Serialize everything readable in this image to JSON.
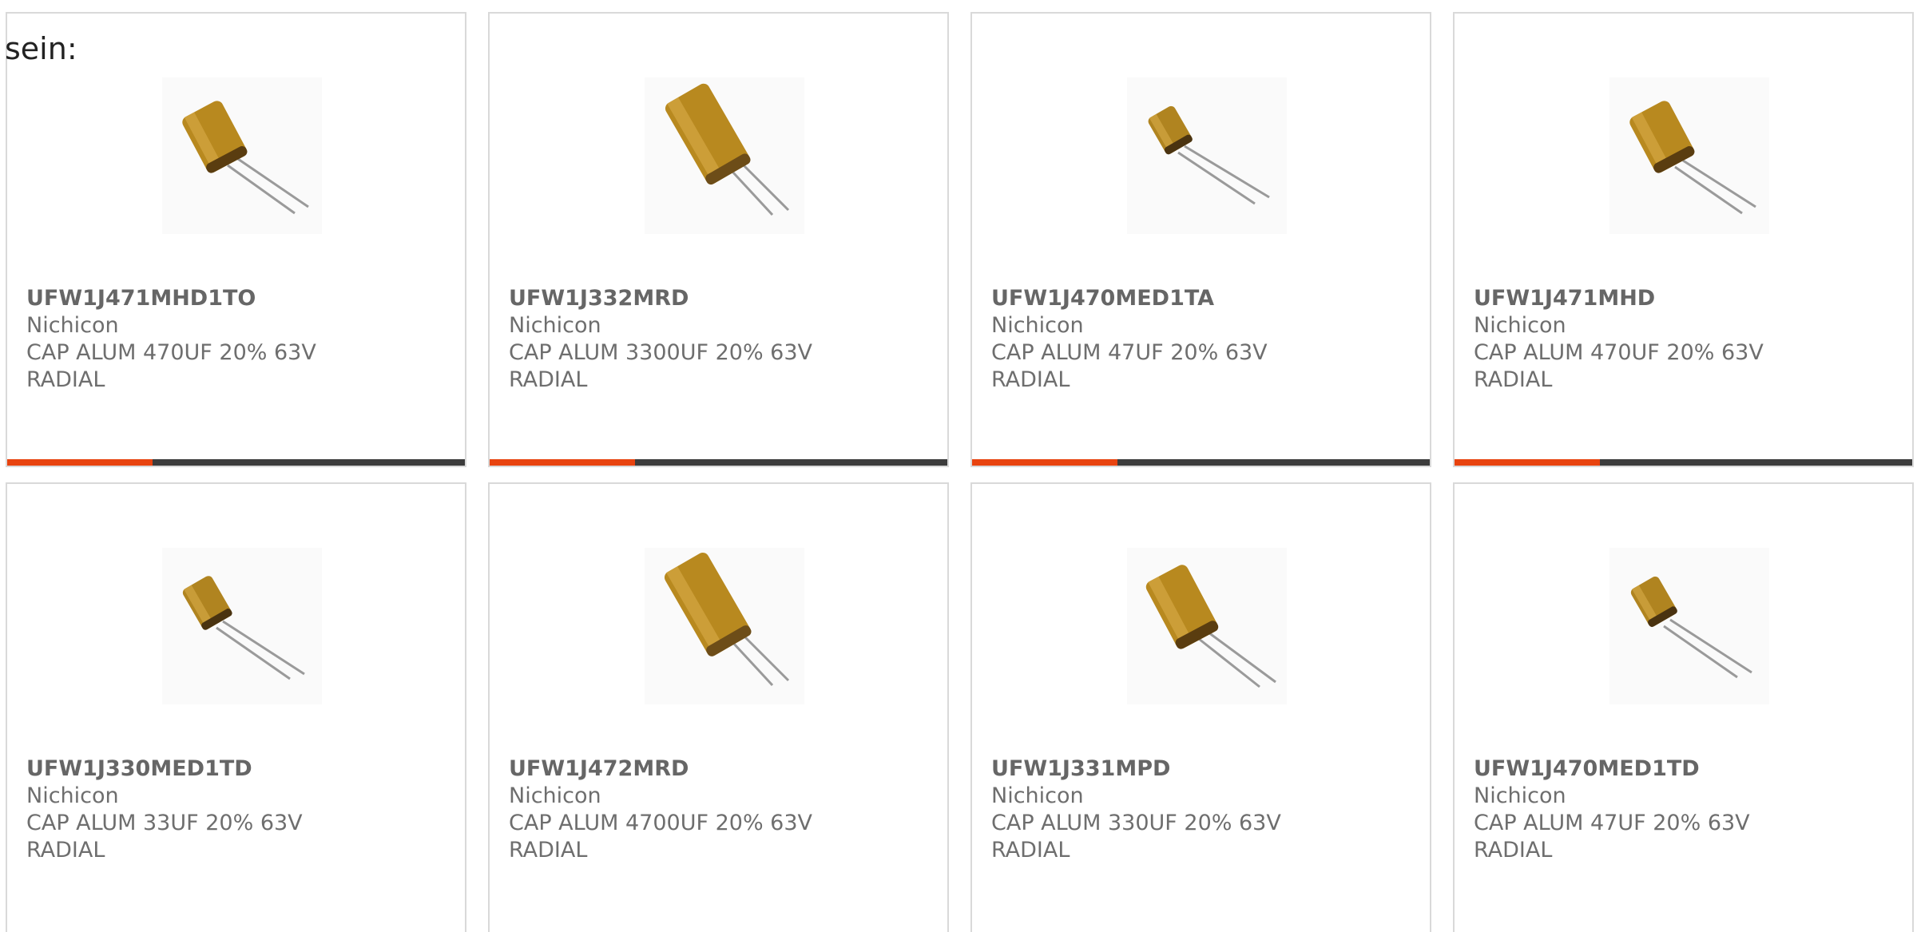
{
  "intro_text": "sein:",
  "accent_color": "#e8430f",
  "bar_color": "#3c3c3c",
  "products": [
    {
      "part": "UFW1J471MHD1TO",
      "brand": "Nichicon",
      "desc": "CAP ALUM 470UF 20% 63V",
      "mount": "RADIAL"
    },
    {
      "part": "UFW1J332MRD",
      "brand": "Nichicon",
      "desc": "CAP ALUM 3300UF 20% 63V",
      "mount": "RADIAL"
    },
    {
      "part": "UFW1J470MED1TA",
      "brand": "Nichicon",
      "desc": "CAP ALUM 47UF 20% 63V",
      "mount": "RADIAL"
    },
    {
      "part": "UFW1J471MHD",
      "brand": "Nichicon",
      "desc": "CAP ALUM 470UF 20% 63V",
      "mount": "RADIAL"
    },
    {
      "part": "UFW1J330MED1TD",
      "brand": "Nichicon",
      "desc": "CAP ALUM 33UF 20% 63V",
      "mount": "RADIAL"
    },
    {
      "part": "UFW1J472MRD",
      "brand": "Nichicon",
      "desc": "CAP ALUM 4700UF 20% 63V",
      "mount": "RADIAL"
    },
    {
      "part": "UFW1J331MPD",
      "brand": "Nichicon",
      "desc": "CAP ALUM 330UF 20% 63V",
      "mount": "RADIAL"
    },
    {
      "part": "UFW1J470MED1TD",
      "brand": "Nichicon",
      "desc": "CAP ALUM 47UF 20% 63V",
      "mount": "RADIAL"
    }
  ],
  "product_image_icon": "radial-capacitor-icon"
}
